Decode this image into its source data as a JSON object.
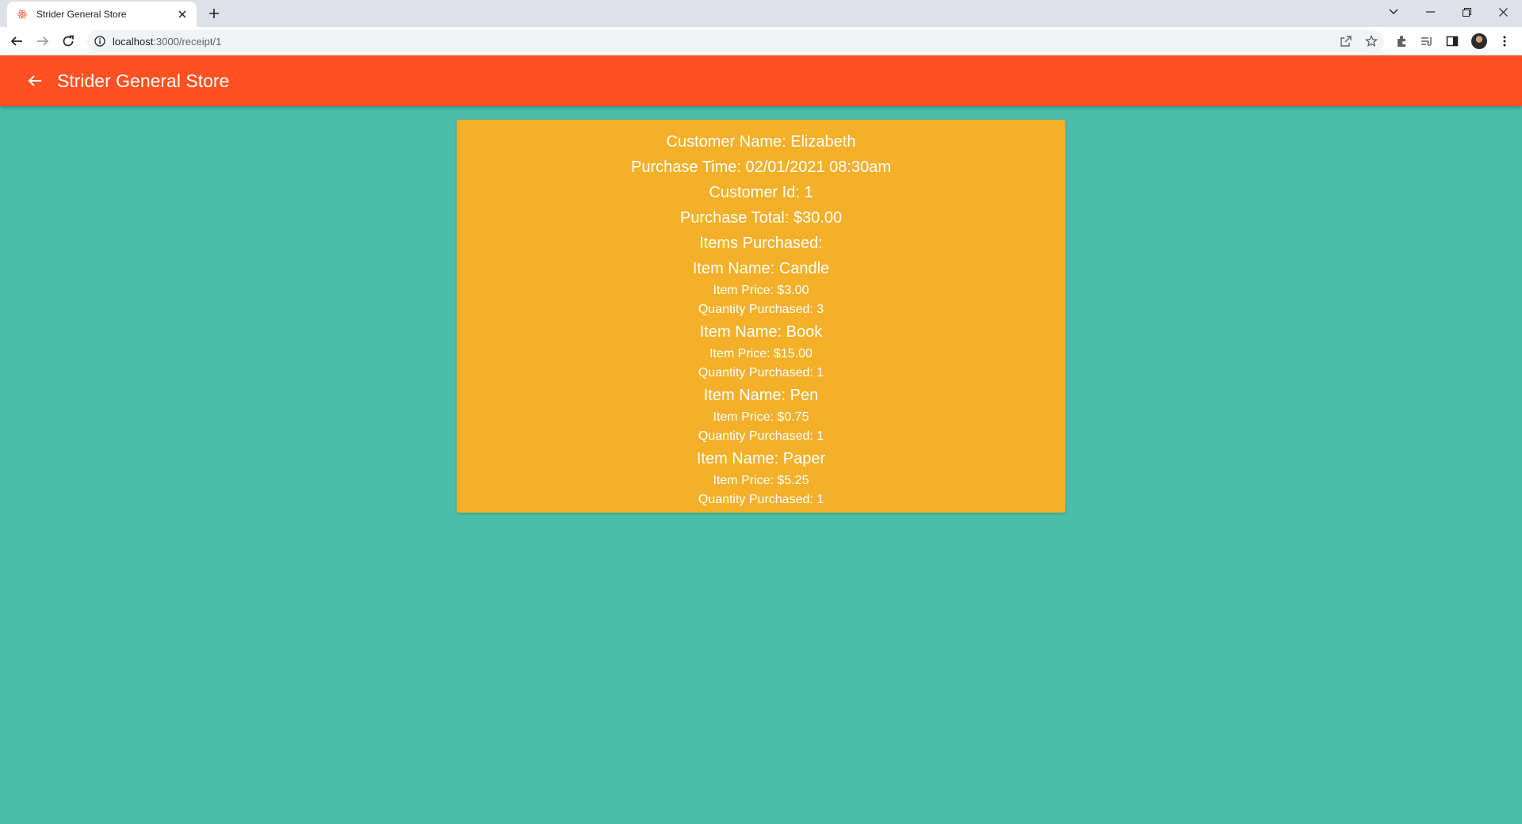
{
  "browser": {
    "tab_title": "Strider General Store",
    "url_host": "localhost",
    "url_path": ":3000/receipt/1"
  },
  "app": {
    "title": "Strider General Store"
  },
  "receipt": {
    "customer_name": "Customer Name: Elizabeth",
    "purchase_time": "Purchase Time: 02/01/2021 08:30am",
    "customer_id": "Customer Id: 1",
    "purchase_total": "Purchase Total: $30.00",
    "items_heading": "Items Purchased:",
    "items": [
      {
        "name": "Item Name: Candle",
        "price": "Item Price: $3.00",
        "quantity": "Quantity Purchased: 3"
      },
      {
        "name": "Item Name: Book",
        "price": "Item Price: $15.00",
        "quantity": "Quantity Purchased: 1"
      },
      {
        "name": "Item Name: Pen",
        "price": "Item Price: $0.75",
        "quantity": "Quantity Purchased: 1"
      },
      {
        "name": "Item Name: Paper",
        "price": "Item Price: $5.25",
        "quantity": "Quantity Purchased: 1"
      }
    ]
  },
  "colors": {
    "app_bar": "#ff5121",
    "page_background": "#4bbdab",
    "card_background": "#f4b028",
    "text": "#ffffff"
  }
}
